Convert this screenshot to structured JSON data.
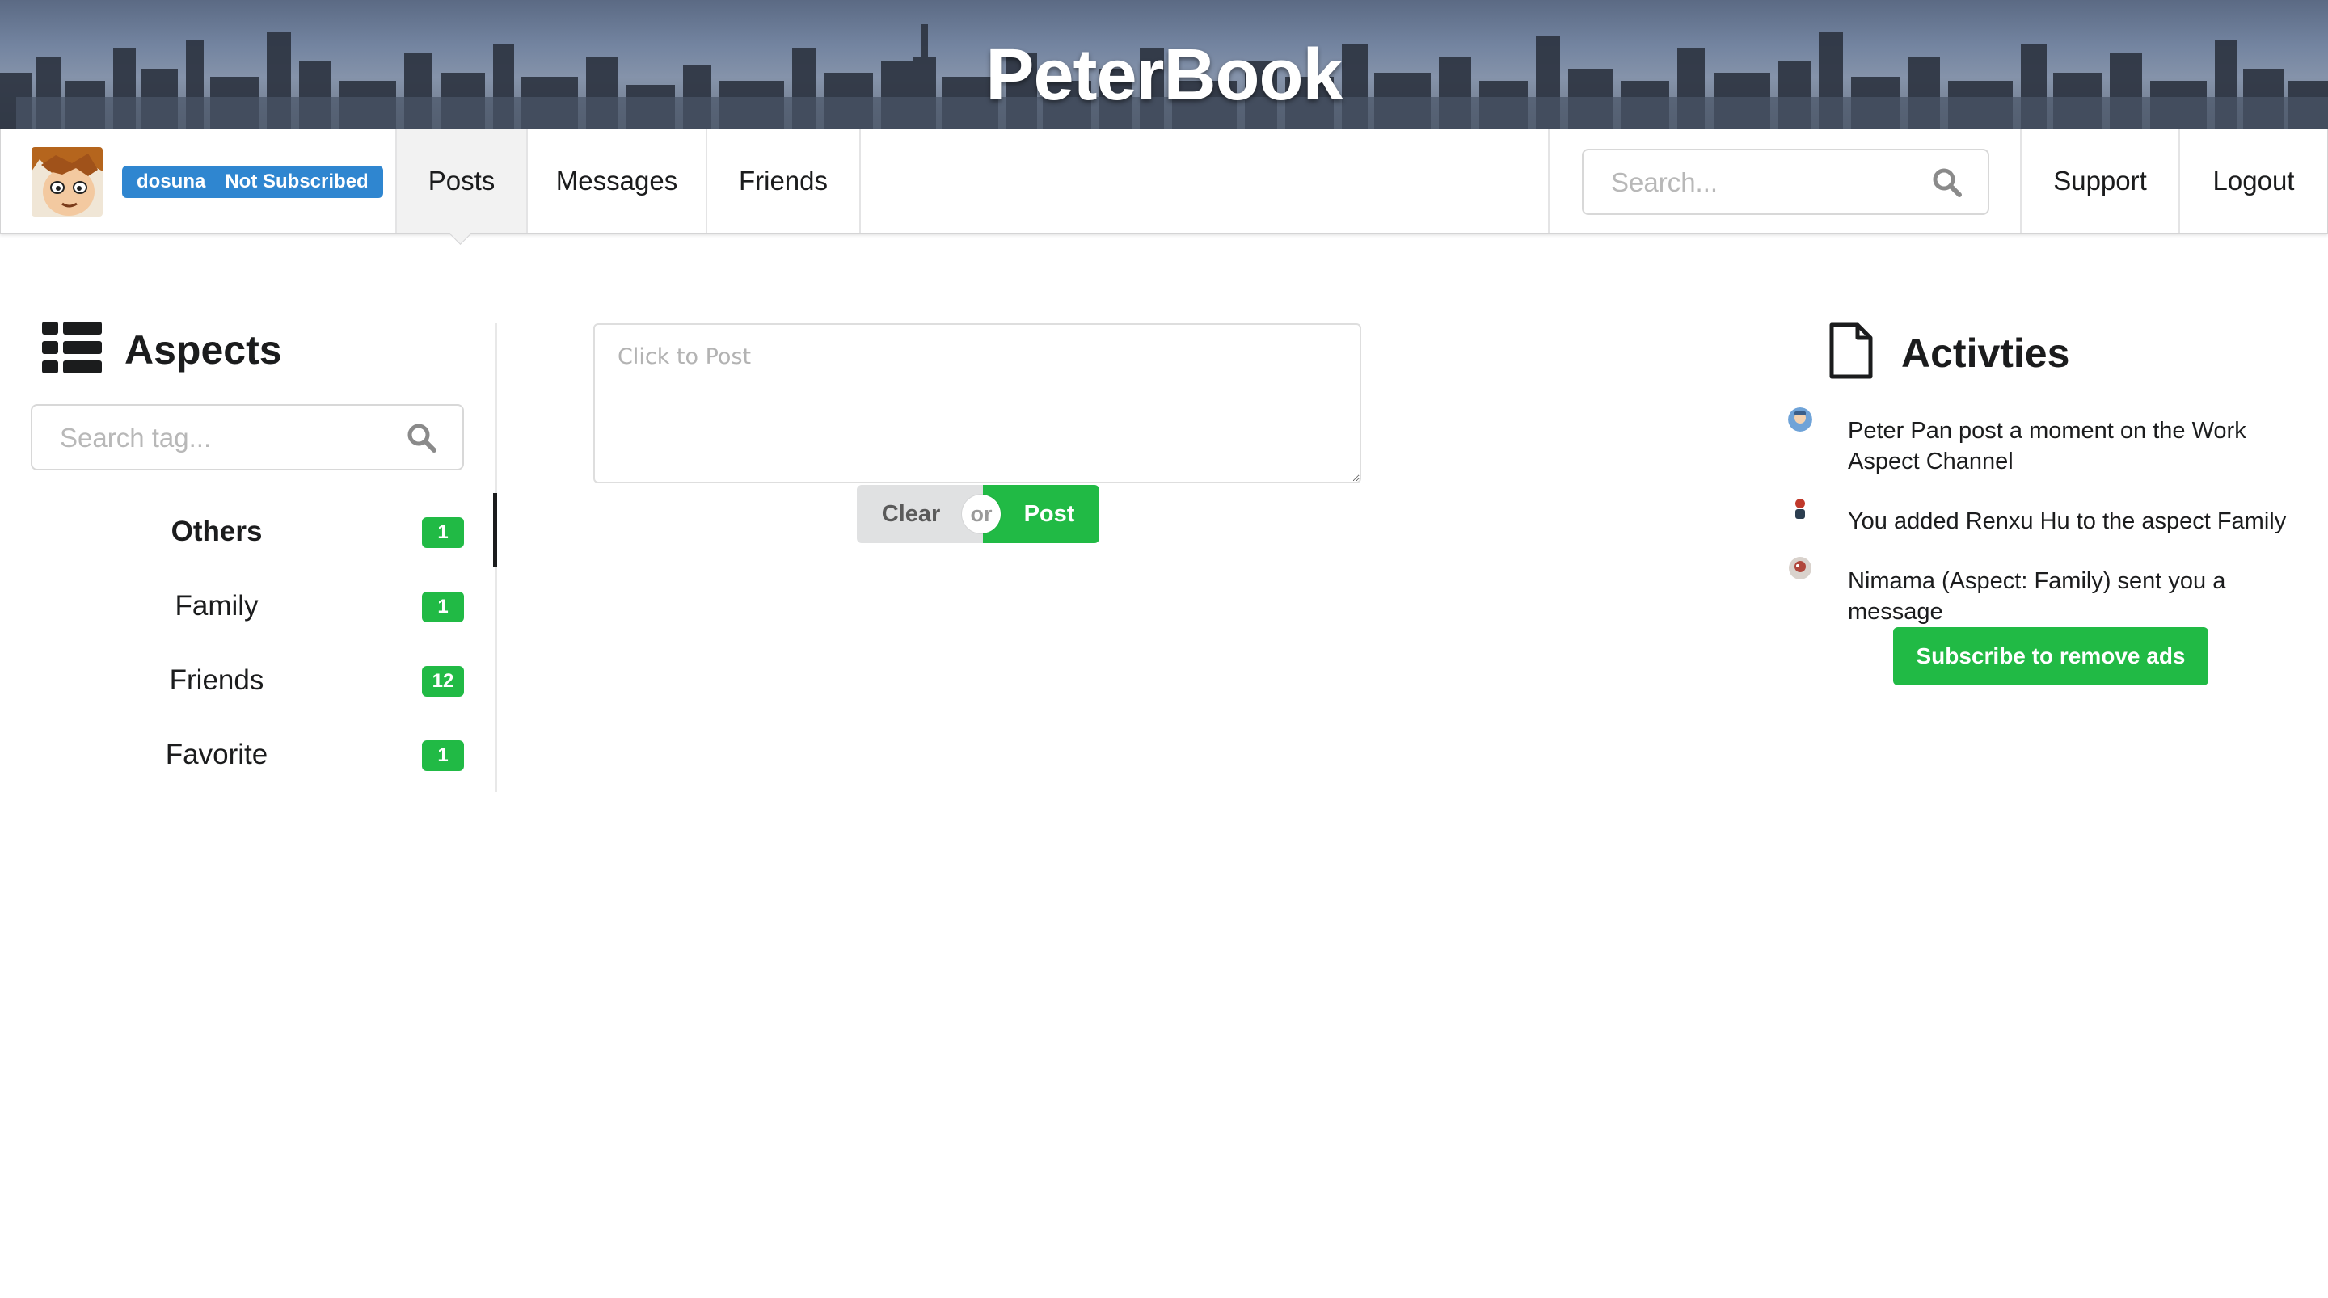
{
  "app": {
    "brand": "PeterBook"
  },
  "user": {
    "name": "dosuna",
    "status": "Not Subscribed"
  },
  "nav": {
    "items": [
      {
        "label": "Posts",
        "active": true
      },
      {
        "label": "Messages",
        "active": false
      },
      {
        "label": "Friends",
        "active": false
      }
    ],
    "search_placeholder": "Search...",
    "support_label": "Support",
    "logout_label": "Logout"
  },
  "aspects": {
    "title": "Aspects",
    "search_placeholder": "Search tag...",
    "items": [
      {
        "label": "Others",
        "count": "1",
        "active": true
      },
      {
        "label": "Family",
        "count": "1",
        "active": false
      },
      {
        "label": "Friends",
        "count": "12",
        "active": false
      },
      {
        "label": "Favorite",
        "count": "1",
        "active": false
      }
    ]
  },
  "composer": {
    "placeholder": "Click to Post",
    "clear_label": "Clear",
    "or_label": "or",
    "post_label": "Post"
  },
  "activities": {
    "title": "Activties",
    "items": [
      {
        "icon": "user-avatar-icon",
        "text": "Peter Pan post a moment on the Work Aspect Channel"
      },
      {
        "icon": "user-avatar-icon",
        "text": "You added Renxu Hu to the aspect Family"
      },
      {
        "icon": "user-avatar-icon",
        "text": "Nimama (Aspect: Family) sent you a message"
      }
    ],
    "subscribe_label": "Subscribe to remove ads"
  },
  "colors": {
    "accent_blue": "#2f86d0",
    "green": "#21ba45",
    "banner": "#6b7a94"
  }
}
